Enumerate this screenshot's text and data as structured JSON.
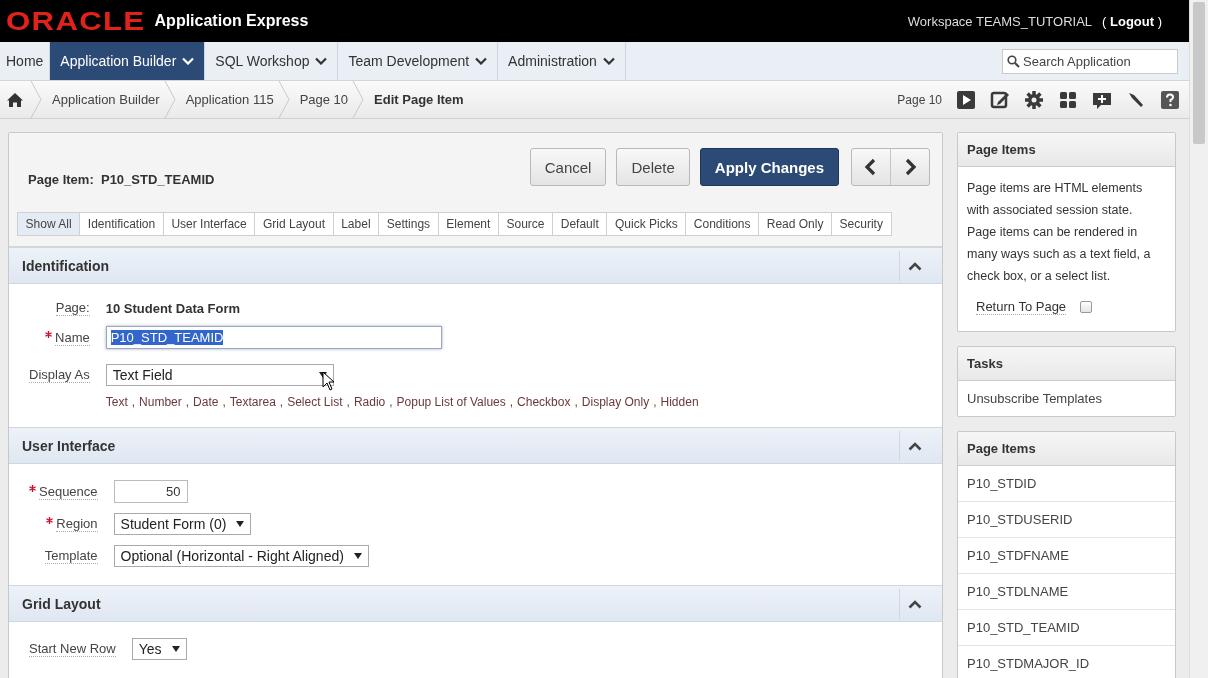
{
  "header": {
    "logo": "ORACLE",
    "product": "Application Express",
    "workspace": "Workspace TEAMS_TUTORIAL",
    "logout": "( **Logout** )"
  },
  "nav": [
    {
      "label": "Home",
      "selected": false,
      "dropdown": false
    },
    {
      "label": "Application Builder",
      "selected": true,
      "dropdown": true
    },
    {
      "label": "SQL Workshop",
      "selected": false,
      "dropdown": true
    },
    {
      "label": "Team Development",
      "selected": false,
      "dropdown": true
    },
    {
      "label": "Administration",
      "selected": false,
      "dropdown": true
    }
  ],
  "search": {
    "placeholder": "Search Application"
  },
  "breadcrumb": [
    {
      "label": "Application Builder",
      "current": false
    },
    {
      "label": "Application 115",
      "current": false
    },
    {
      "label": "Page 10",
      "current": false
    },
    {
      "label": "Edit Page Item",
      "current": true
    }
  ],
  "toolbar": {
    "page_label": "Page 10"
  },
  "item_header": {
    "title": "Page Item:  P10_STD_TEAMID",
    "buttons": [
      {
        "label": "Cancel",
        "kind": "default"
      },
      {
        "label": "Delete",
        "kind": "default"
      },
      {
        "label": "Apply Changes",
        "kind": "primary"
      }
    ]
  },
  "section_tabs": [
    {
      "label": "Show All",
      "selected": true
    },
    {
      "label": "Identification",
      "selected": false
    },
    {
      "label": "User Interface",
      "selected": false
    },
    {
      "label": "Grid Layout",
      "selected": false
    },
    {
      "label": "Label",
      "selected": false
    },
    {
      "label": "Settings",
      "selected": false
    },
    {
      "label": "Element",
      "selected": false
    },
    {
      "label": "Source",
      "selected": false
    },
    {
      "label": "Default",
      "selected": false
    },
    {
      "label": "Quick Picks",
      "selected": false
    },
    {
      "label": "Conditions",
      "selected": false
    },
    {
      "label": "Read Only",
      "selected": false
    },
    {
      "label": "Security",
      "selected": false
    }
  ],
  "sections": [
    {
      "title": "Identification",
      "expanded": true,
      "fields": [
        {
          "kind": "static",
          "label": "Page:",
          "required": false,
          "value": "10 Student Data Form"
        },
        {
          "kind": "text",
          "label": "Name",
          "required": true,
          "value": "P10_STD_TEAMID",
          "highlighted": true
        },
        {
          "kind": "select",
          "label": "Display As",
          "required": false,
          "value": "Text Field",
          "option_separator": ",",
          "options": [
            "Text",
            "Number",
            "Date",
            "Textarea",
            "Select List",
            "Radio",
            "Popup List of Values",
            "Checkbox",
            "Display Only",
            "Hidden"
          ]
        }
      ]
    },
    {
      "title": "User Interface",
      "expanded": true,
      "fields": [
        {
          "kind": "number",
          "label": "Sequence",
          "required": true,
          "value": "50"
        },
        {
          "kind": "select",
          "label": "Region",
          "required": true,
          "value": "Student Form (0)"
        },
        {
          "kind": "select",
          "label": "Template",
          "required": false,
          "value": "Optional (Horizontal - Right Aligned)"
        }
      ]
    },
    {
      "title": "Grid Layout",
      "expanded": true,
      "fields": [
        {
          "kind": "select",
          "label": "Start New Row",
          "required": false,
          "value": "Yes"
        }
      ]
    }
  ],
  "sidebar": [
    {
      "kind": "text",
      "title": "Page Items",
      "text": "Page items are HTML elements with associated session state. Page items can be rendered in many ways such as a text field, a check box, or a select list.",
      "checkbox": {
        "label": "Return To Page",
        "checked": false
      }
    },
    {
      "kind": "links",
      "title": "Tasks",
      "items": [
        "Unsubscribe Templates"
      ]
    },
    {
      "kind": "list",
      "title": "Page Items",
      "items": [
        "P10_STDID",
        "P10_STDUSERID",
        "P10_STDFNAME",
        "P10_STDLNAME",
        "P10_STD_TEAMID",
        "P10_STDMAJOR_ID"
      ]
    }
  ]
}
